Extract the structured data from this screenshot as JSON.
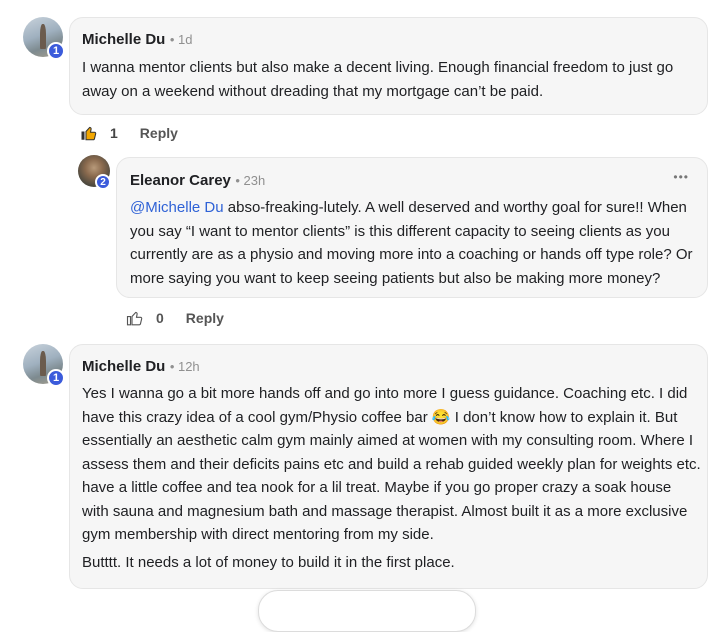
{
  "comments": [
    {
      "author": "Michelle Du",
      "time": "• 1d",
      "badge": "1",
      "text": "I wanna mentor clients but also make a decent living. Enough financial freedom to just go away on a weekend without dreading that my mortgage can’t be paid.",
      "likes": "1",
      "reply_label": "Reply",
      "liked": true
    },
    {
      "author": "Eleanor Carey",
      "time": "• 23h",
      "badge": "2",
      "mention": "@Michelle Du",
      "text": " abso-freaking-lutely. A well deserved and worthy goal for sure!! When you say “I want to mentor clients” is this different capacity to seeing clients as you currently are as a physio and moving more into a coaching or hands off type role? Or more saying you want to keep seeing patients but also be making more money?",
      "likes": "0",
      "reply_label": "Reply",
      "menu": "•••"
    },
    {
      "author": "Michelle Du",
      "time": "• 12h",
      "badge": "1",
      "paragraph1": "Yes I wanna go a bit more hands off and go into more I guess guidance. Coaching etc. I did have this crazy idea of a cool gym/Physio coffee bar 😂 I don’t know how to explain it. But essentially an aesthetic calm gym mainly aimed at women with my consulting room. Where I assess them and their deficits pains etc and build a rehab guided weekly plan for weights etc. have a little coffee and tea nook for a lil treat. Maybe if you go proper crazy a soak house with sauna and magnesium bath and massage therapist. Almost built it as a more exclusive gym membership with direct mentoring from my side.",
      "paragraph2": "Butttt. It needs a lot of money to build it in the first place."
    }
  ],
  "colors": {
    "accent": "#2f62d6",
    "badge": "#3b5bdb",
    "liked": "#f2a600"
  }
}
